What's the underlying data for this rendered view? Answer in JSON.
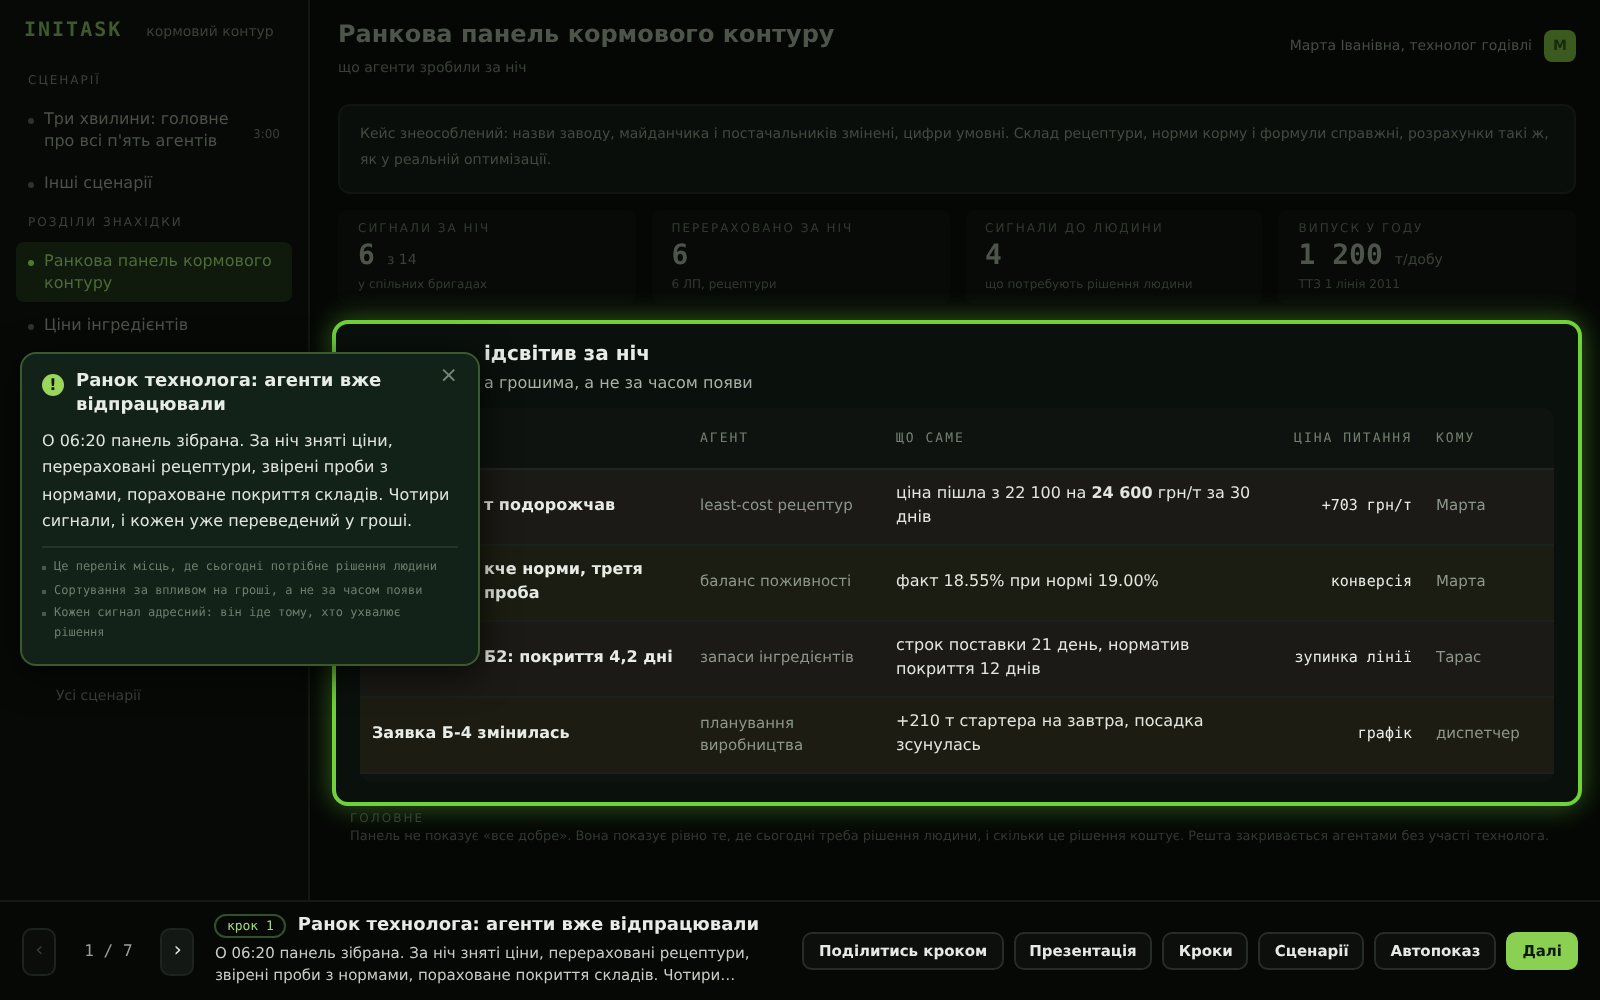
{
  "app": {
    "logo": "INITASK",
    "subtitle": "кормовий контур"
  },
  "sidebar": {
    "sections": [
      {
        "heading": "СЦЕНАРІЇ",
        "items": [
          {
            "label": "Три хвилини: головне про всі п'ять агентів",
            "badge": "3:00",
            "selected": false
          },
          {
            "label": "Інші сценарії",
            "selected": false
          }
        ]
      },
      {
        "heading": "РОЗДІЛИ ЗНАХІДКИ",
        "items": [
          {
            "label": "Ранкова панель кормового контуру",
            "selected": true
          },
          {
            "label": "Ціни інгредієнтів",
            "selected": false
          }
        ]
      }
    ],
    "footer_link": "Усі сценарії"
  },
  "header": {
    "title": "Ранкова панель кормового контуру",
    "subtitle": "що агенти зробили за ніч",
    "user": "Марта Іванівна, технолог годівлі",
    "avatar": "М"
  },
  "notice": "Кейс знеособлений: назви заводу, майданчика і постачальників змінені, цифри умовні. Склад рецептури, норми корму і формули справжні, розрахунки такі ж, як у реальній оптимізації.",
  "stats": [
    {
      "label": "СИГНАЛИ ЗА НІЧ",
      "value": "6",
      "unit": "з 14",
      "note": "у спільних бригадах"
    },
    {
      "label": "ПЕРЕРАХОВАНО ЗА НІЧ",
      "value": "6",
      "note": "6 ЛП, рецептури"
    },
    {
      "label": "СИГНАЛИ ДО ЛЮДИНИ",
      "value": "4",
      "note": "що потребують рішення людини"
    },
    {
      "label": "ВИПУСК У ГОДУ",
      "value": "1 200",
      "unit": "т/добу",
      "note": "ТТЗ 1 лінія 2011"
    }
  ],
  "card": {
    "title": "ідсвітив за ніч",
    "subtitle": "а грошима, а не за часом появи",
    "table": {
      "columns": [
        "АГЕНТ",
        "ЩО САМЕ",
        "ЦІНА ПИТАННЯ",
        "КОМУ"
      ],
      "rows": [
        {
          "signal": "т подорожчав",
          "agent": "least-cost рецептур",
          "detail": "ціна пішла з 22 100 на **24 600** грн/т за 30 днів",
          "cost": "+703 грн/т",
          "to": "Марта"
        },
        {
          "signal": "кче норми, третя проба",
          "agent": "баланс поживності",
          "detail": "факт 18.55% при нормі 19.00%",
          "cost": "конверсія",
          "to": "Марта"
        },
        {
          "signal": "Б2: покриття 4,2 дні",
          "agent": "запаси інгредієнтів",
          "detail": "строк поставки 21 день, норматив покриття 12 днів",
          "cost": "зупинка лінії",
          "to": "Тарас"
        },
        {
          "signal": "Заявка Б-4 змінилась",
          "agent": "планування виробництва",
          "detail": "+210 т стартера на завтра, посадка зсунулась",
          "cost": "графік",
          "to": "диспетчер"
        }
      ]
    }
  },
  "summary": {
    "heading": "ГОЛОВНЕ",
    "text": "Панель не показує «все добре». Вона показує рівно те, де сьогодні треба рішення людини, і скільки це рішення коштує. Решта закривається агентами без участі технолога."
  },
  "popover": {
    "icon": "!",
    "title": "Ранок технолога: агенти вже відпрацювали",
    "close": "×",
    "body": "О 06:20 панель зібрана. За ніч зняті ціни, перераховані рецептури, звірені проби з нормами, пораховане покриття складів. Чотири сигнали, і кожен уже переведений у гроші.",
    "points": [
      "Це перелік місць, де сьогодні потрібне рішення людини",
      "Сортування за впливом на гроші, а не за часом появи",
      "Кожен сигнал адресний: він іде тому, хто ухвалює рішення"
    ]
  },
  "tour": {
    "prev": "‹",
    "prev_disabled": true,
    "counter": "1 / 7",
    "next": "›",
    "step": "крок 1",
    "title": "Ранок технолога: агенти вже відпрацювали",
    "text": "О 06:20 панель зібрана. За ніч зняті ціни, перераховані рецептури, звірені проби з нормами, пораховане покриття складів. Чотири…",
    "buttons": [
      {
        "label": "Поділитись кроком",
        "primary": false
      },
      {
        "label": "Презентація",
        "primary": false
      },
      {
        "label": "Кроки",
        "primary": false
      },
      {
        "label": "Сценарії",
        "primary": false
      },
      {
        "label": "Автопоказ",
        "primary": false
      },
      {
        "label": "Далі",
        "primary": true
      }
    ]
  }
}
